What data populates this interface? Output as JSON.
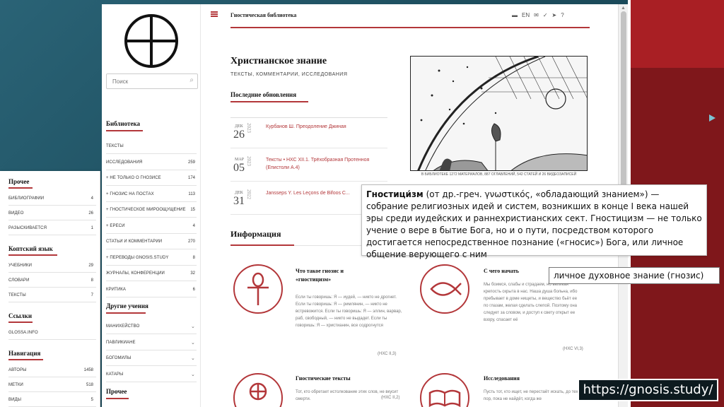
{
  "colors": {
    "accent": "#b3373a",
    "slide_red": "#a91f24",
    "slide_bg": "#1f5566"
  },
  "site": {
    "title": "Гностическая библиотека",
    "lang": "EN",
    "search_placeholder": "Поиск",
    "heading": "Христианское знание",
    "subtitle": "ТЕКСТЫ, КОММЕНТАРИИ, ИССЛЕДОВАНИЯ",
    "updates_heading": "Последние обновления",
    "updates": [
      {
        "month": "ДЕК",
        "day": "26",
        "year": "2023",
        "title": "Курбанов Ш. Преодоление Джиная"
      },
      {
        "month": "МАР",
        "day": "05",
        "year": "2023",
        "title": "Тексты • НХС XII.1. Трёхобразная Протенноя (Епистоли A.4)"
      },
      {
        "month": "ДЕК",
        "day": "31",
        "year": "2022",
        "title": "Jansseps Y. Les Leçons de Bifoos C..."
      }
    ],
    "engraving_caption": "В БИБЛИОТЕКЕ 1272 МАТЕРИАЛОВ, 887 ОГЛАВЛЕНИЙ, 542 СТАТЕЙ И 26 ВИДЕОЗАПИСЕЙ",
    "info_heading": "Информация",
    "cards": [
      {
        "title": "Что такое гнозис и «гностицизм»",
        "text": "Если ты говоришь: Я — иудей, — никто не дрогнет. Если ты говоришь: Я — римлянин, — никто не встревожится. Если ты говоришь: Я — эллин, варвар, раб, свободный, — никто не выдадет. Если ты говоришь: Я — христианин, все содрогнутся",
        "ref": "(НХС II,3)"
      },
      {
        "title": "С чего начать",
        "text": "Мы боимся, слабы и страдаем, но великая крепость скрыта в нас. Наша душа больна, ибо пребывает в доме нищеты, и вещество бьёт ее по глазам, желая сделать слепой. Поэтому она следует за словом, и доступ к свету открыт ее взору, спасает её",
        "ref": "(НХС VI,3)"
      },
      {
        "title": "Гностические тексты",
        "text": "Тот, кто обретает истолкование этих слов, не вкусит смерти.",
        "ref": "(НХС II,2)"
      },
      {
        "title": "Исследования",
        "text": "Пусть тот, кто ищет, не перестаёт искать, до тех пор, пока не найдёт, когда же",
        "ref": ""
      }
    ]
  },
  "sidebar": {
    "library_title": "Библиотека",
    "library_items": [
      {
        "label": "ТЕКСТЫ",
        "count": ""
      },
      {
        "label": "ИССЛЕДОВАНИЯ",
        "count": "259"
      },
      {
        "label": "+ НЕ ТОЛЬКО О ГНОЗИСЕ",
        "count": "174"
      },
      {
        "label": "+ ГНОЗИС НА ПОСТАХ",
        "count": "113"
      },
      {
        "label": "+ ГНОСТИЧЕСКОЕ МИРООЩУЩЕНИЕ",
        "count": "15"
      },
      {
        "label": "+ ЕРЕСИ",
        "count": "4"
      },
      {
        "label": "СТАТЬИ И КОММЕНТАРИИ",
        "count": "270"
      },
      {
        "label": "+ ПЕРЕВОДЫ GNOSIS.STUDY",
        "count": "8"
      },
      {
        "label": "ЖУРНАЛЫ, КОНФЕРЕНЦИИ",
        "count": "32"
      },
      {
        "label": "КРИТИКА",
        "count": "6"
      }
    ],
    "other_title": "Другие учения",
    "other_items": [
      "МАНИХЕЙСТВО",
      "ПАВЛИКИАНЕ",
      "БОГОМИЛЫ",
      "КАТАРЫ"
    ],
    "more_title": "Прочее"
  },
  "overlay": {
    "sections": [
      {
        "title": "Прочее",
        "items": [
          {
            "label": "БИБЛИОГРАФИИ",
            "count": "4"
          },
          {
            "label": "ВИДЕО",
            "count": "26"
          },
          {
            "label": "РАЗЫСКИВАЕТСЯ",
            "count": "1"
          }
        ]
      },
      {
        "title": "Коптский язык",
        "items": [
          {
            "label": "УЧЕБНИКИ",
            "count": "29"
          },
          {
            "label": "СЛОВАРИ",
            "count": "8"
          },
          {
            "label": "ТЕКСТЫ",
            "count": "7"
          }
        ]
      },
      {
        "title": "Ссылки",
        "items": [
          {
            "label": "GLOSSA.INFO",
            "count": ""
          }
        ]
      },
      {
        "title": "Навигация",
        "items": [
          {
            "label": "АВТОРЫ",
            "count": "1458"
          },
          {
            "label": "МЕТКИ",
            "count": "518"
          },
          {
            "label": "ВИДЫ",
            "count": "5"
          }
        ]
      }
    ]
  },
  "popup": {
    "term": "Гностици́зм",
    "definition": " (от др.-греч. γνωστικός, «обладающий знанием») — собрание религиозных идей и систем, возникших в конце I века нашей эры среди иудейских и раннехристианских сект. Гностицизм — не только учение о вере в бытие Бога, но и о пути, посредством которого достигается непосредственное познание («гносис») Бога, или личное общение верующего с ним"
  },
  "note": "личное духовное знание (гнозис)",
  "url": "https://gnosis.study/"
}
